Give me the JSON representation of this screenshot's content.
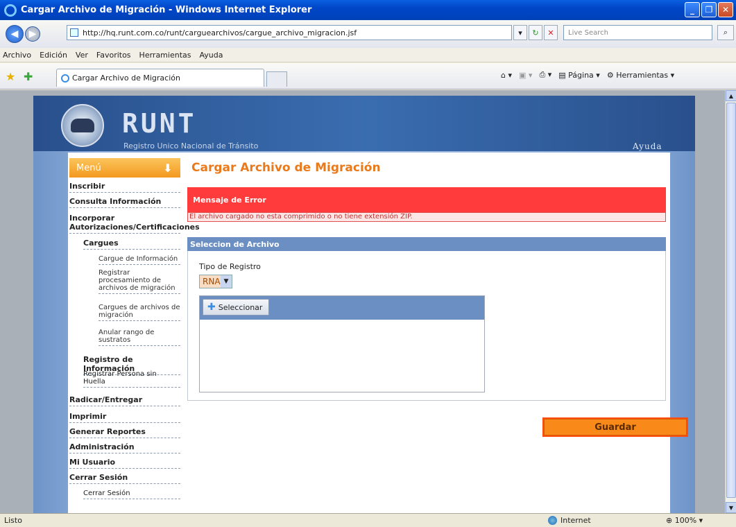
{
  "window": {
    "title": "Cargar Archivo de Migración - Windows Internet Explorer"
  },
  "address": {
    "url": "http://hq.runt.com.co/runt/carguearchivos/cargue_archivo_migracion.jsf",
    "search_placeholder": "Live Search"
  },
  "menubar": [
    "Archivo",
    "Edición",
    "Ver",
    "Favoritos",
    "Herramientas",
    "Ayuda"
  ],
  "tab": {
    "label": "Cargar Archivo de Migración"
  },
  "commands": {
    "pagina": "Página",
    "herramientas": "Herramientas"
  },
  "status": {
    "text": "Listo",
    "zone": "Internet",
    "zoom": "100%"
  },
  "site": {
    "brand": "RUNT",
    "subtitle": "Registro Unico Nacional de Tránsito",
    "help": "Ayuda"
  },
  "menu": {
    "title": "Menú",
    "items": [
      "Inscribir",
      "Consulta Información",
      "Incorporar Autorizaciones/Certificaciones",
      "Cargues",
      "Cargue de Información",
      "Registrar procesamiento de archivos de migración",
      "Cargues de archivos de migración",
      "Anular rango de sustratos",
      "Registro de Información",
      "Registrar Persona sin Huella",
      "Radicar/Entregar",
      "Imprimir",
      "Generar Reportes",
      "Administración",
      "Mi Usuario",
      "Cerrar Sesión",
      "Cerrar Sesión"
    ]
  },
  "content": {
    "title": "Cargar Archivo de Migración",
    "error_title": "Mensaje de Error",
    "error_msg": "El archivo cargado no esta comprimido o no tiene extensión ZIP.",
    "section_title": "Seleccion de Archivo",
    "tipo_label": "Tipo de Registro",
    "tipo_value": "RNA",
    "select_button": "Seleccionar",
    "save_button": "Guardar"
  },
  "colors": {
    "accent": "#e97a1c",
    "error": "#ff3b3b",
    "section": "#6b8fc2"
  }
}
